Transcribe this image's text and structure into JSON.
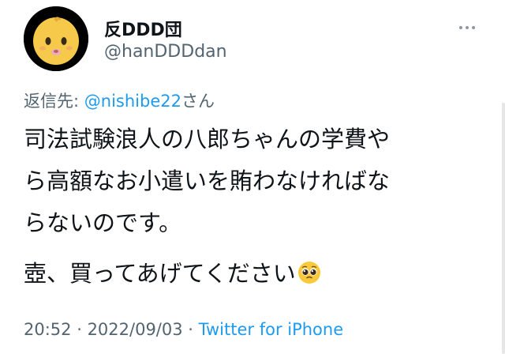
{
  "author": {
    "avatar_icon": "baby-emoji-icon",
    "display_name": "反DDD団",
    "handle": "@hanDDDdan"
  },
  "header": {
    "more_icon": "more-horizontal-icon"
  },
  "reply": {
    "prefix": "返信先: ",
    "mention": "@nishibe22",
    "suffix": "さん"
  },
  "tweet": {
    "line1": "司法試験浪人の八郎ちゃんの学費や",
    "line2": "ら高額なお小遣いを賄わなければな",
    "line3": "らないのです。",
    "paragraph2": "壺、買ってあげてください",
    "emoji_icon": "pleading-face-icon"
  },
  "meta": {
    "time": "20:52",
    "sep1": " · ",
    "date": "2022/09/03",
    "sep2": " · ",
    "source": "Twitter for iPhone"
  },
  "colors": {
    "text": "#0f1419",
    "secondary": "#536471",
    "link": "#1d9bf0"
  }
}
